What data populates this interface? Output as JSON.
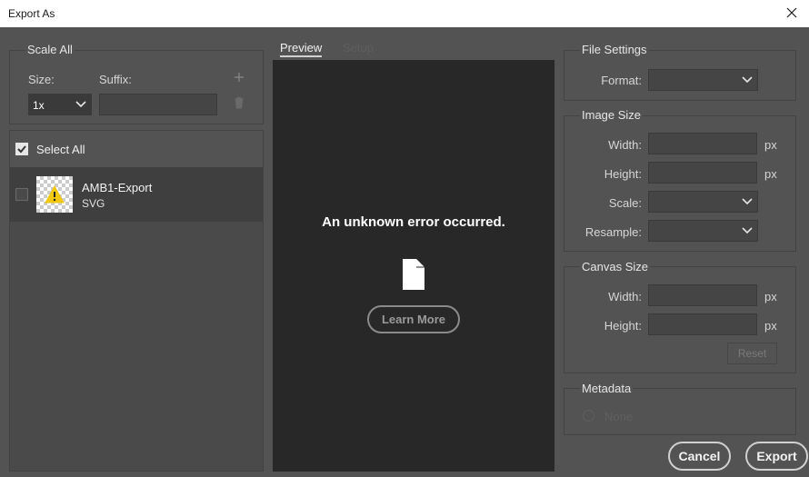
{
  "window": {
    "title": "Export As"
  },
  "scale_all": {
    "title": "Scale All",
    "size_label": "Size:",
    "suffix_label": "Suffix:",
    "size_value": "1x",
    "suffix_value": ""
  },
  "assets": {
    "select_all_label": "Select All",
    "select_all_checked": true,
    "items": [
      {
        "name": "AMB1-Export",
        "format": "SVG",
        "checked": false
      }
    ]
  },
  "tabs": [
    {
      "label": "Preview",
      "active": true
    },
    {
      "label": "Setup",
      "active": false
    }
  ],
  "preview": {
    "error_message": "An unknown error occurred.",
    "learn_more_label": "Learn More"
  },
  "file_settings": {
    "title": "File Settings",
    "format_label": "Format:",
    "format_value": ""
  },
  "image_size": {
    "title": "Image Size",
    "width_label": "Width:",
    "height_label": "Height:",
    "scale_label": "Scale:",
    "resample_label": "Resample:",
    "unit": "px"
  },
  "canvas_size": {
    "title": "Canvas Size",
    "width_label": "Width:",
    "height_label": "Height:",
    "unit": "px",
    "reset_label": "Reset"
  },
  "metadata": {
    "title": "Metadata",
    "none_label": "None"
  },
  "footer": {
    "cancel_label": "Cancel",
    "export_label": "Export"
  },
  "colors": {
    "background": "#535353",
    "preview_background": "#282828",
    "warning_yellow": "#f2c811",
    "titlebar": "#ffffff"
  }
}
